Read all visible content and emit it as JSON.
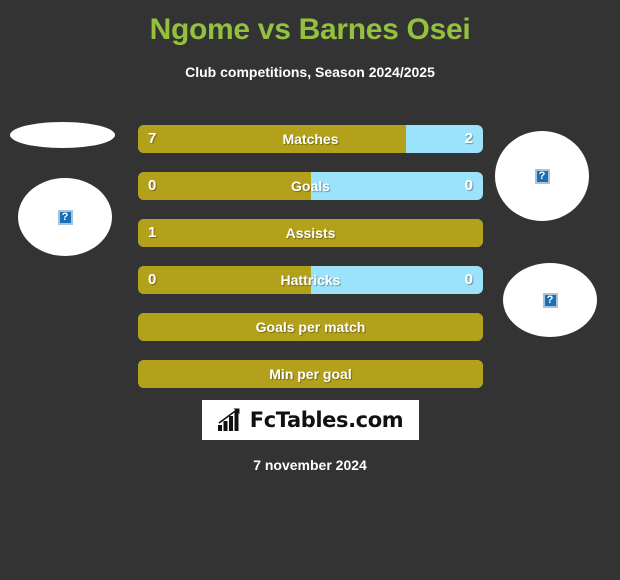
{
  "header": {
    "title": "Ngome vs Barnes Osei",
    "subtitle": "Club competitions, Season 2024/2025",
    "title_color": "#93c13e"
  },
  "colors": {
    "background": "#333333",
    "home_bar": "#b3a11c",
    "away_bar": "#9be3fb",
    "text": "#ffffff"
  },
  "placeholders": [
    {
      "name": "home-player-photo-top",
      "icon": "broken-image-icon",
      "glyph": "?"
    },
    {
      "name": "home-player-photo",
      "icon": "broken-image-icon",
      "glyph": "?"
    },
    {
      "name": "away-player-photo",
      "icon": "broken-image-icon",
      "glyph": "?"
    },
    {
      "name": "away-player-photo-bottom",
      "icon": "broken-image-icon",
      "glyph": "?"
    }
  ],
  "stats": [
    {
      "label": "Matches",
      "home": "7",
      "away": "2",
      "home_pct": 77.8,
      "show_home": true,
      "show_away": true
    },
    {
      "label": "Goals",
      "home": "0",
      "away": "0",
      "home_pct": 50,
      "show_home": true,
      "show_away": true
    },
    {
      "label": "Assists",
      "home": "1",
      "away": "",
      "home_pct": 100,
      "show_home": true,
      "show_away": false
    },
    {
      "label": "Hattricks",
      "home": "0",
      "away": "0",
      "home_pct": 50,
      "show_home": true,
      "show_away": true
    },
    {
      "label": "Goals per match",
      "home": "",
      "away": "",
      "home_pct": 100,
      "show_home": false,
      "show_away": false
    },
    {
      "label": "Min per goal",
      "home": "",
      "away": "",
      "home_pct": 100,
      "show_home": false,
      "show_away": false
    }
  ],
  "logo": {
    "text": "FcTables.com",
    "icon": "bar-chart-arrow-icon"
  },
  "footer": {
    "date": "7 november 2024"
  }
}
